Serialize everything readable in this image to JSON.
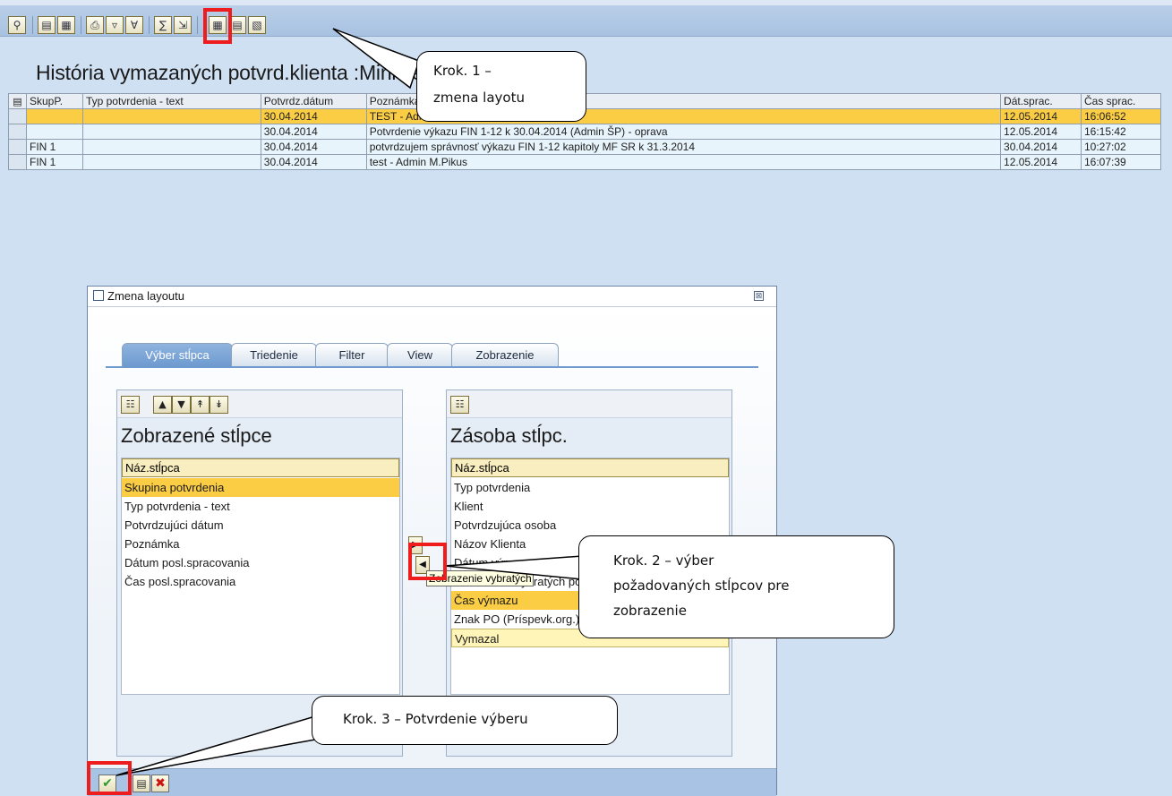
{
  "toolbar": {
    "icons": [
      "details-icon",
      "select-all-icon",
      "deselect-all-icon",
      "print-icon",
      "filter-icon",
      "set-filter-icon",
      "sum-icon",
      "export-icon",
      "change-layout-icon",
      "select-layout-icon",
      "save-layout-icon"
    ]
  },
  "page": {
    "title": "História vymazaných potvrd.klienta :Ministerstvo financií"
  },
  "grid": {
    "columns": [
      "SkupP.",
      "Typ potvrdenia - text",
      "Potvrdz.dátum",
      "Poznámka",
      "Dát.sprac.",
      "Čas sprac."
    ],
    "rows": [
      {
        "skup": "",
        "typ": "",
        "datum": "30.04.2014",
        "poznamka": "TEST - Admin M.Pikus",
        "dat_sprac": "12.05.2014",
        "cas_sprac": "16:06:52"
      },
      {
        "skup": "",
        "typ": "",
        "datum": "30.04.2014",
        "poznamka": "Potvrdenie výkazu FIN 1-12 k 30.04.2014 (Admin ŠP) - oprava",
        "dat_sprac": "12.05.2014",
        "cas_sprac": "16:15:42"
      },
      {
        "skup": "FIN 1",
        "typ": "",
        "datum": "30.04.2014",
        "poznamka": "potvrdzujem správnosť výkazu FIN 1-12 kapitoly MF SR k 31.3.2014",
        "dat_sprac": "30.04.2014",
        "cas_sprac": "10:27:02"
      },
      {
        "skup": "FIN 1",
        "typ": "",
        "datum": "30.04.2014",
        "poznamka": "test - Admin M.Pikus",
        "dat_sprac": "12.05.2014",
        "cas_sprac": "16:07:39"
      }
    ]
  },
  "dialog": {
    "title": "Zmena layoutu",
    "close_symbol": "⊠",
    "tabs": [
      "Výber stĺpca",
      "Triedenie",
      "Filter",
      "View",
      "Zobrazenie"
    ],
    "left": {
      "title": "Zobrazené stĺpce",
      "header": "Náz.stĺpca",
      "items": [
        "Skupina potvrdenia",
        "Typ potvrdenia - text",
        "Potvrdzujúci dátum",
        "Poznámka",
        "Dátum posl.spracovania",
        "Čas posl.spracovania"
      ]
    },
    "right": {
      "title": "Zásoba stĺpc.",
      "header": "Náz.stĺpca",
      "items": [
        "Typ potvrdenia",
        "Klient",
        "Potvrdzujúca osoba",
        "Názov Klienta",
        "Dátum výmazu",
        "Zobrazenie vybratých pol.",
        "Čas výmazu",
        "Znak PO (Príspevk.org.)",
        "Vymazal"
      ]
    },
    "tooltip": "Zobrazenie vybratých pol."
  },
  "callouts": {
    "step1_line1": "Krok. 1 –",
    "step1_line2": "zmena layotu",
    "step2_line1": "Krok. 2 – výber",
    "step2_line2": "požadovaných stĺpcov pre",
    "step2_line3": "zobrazenie",
    "step3": "Krok. 3 – Potvrdenie výberu"
  },
  "colors": {
    "selection": "#fbcd45",
    "annotation_red": "#ee1c1c",
    "tab_active": "#6e9ad0"
  }
}
